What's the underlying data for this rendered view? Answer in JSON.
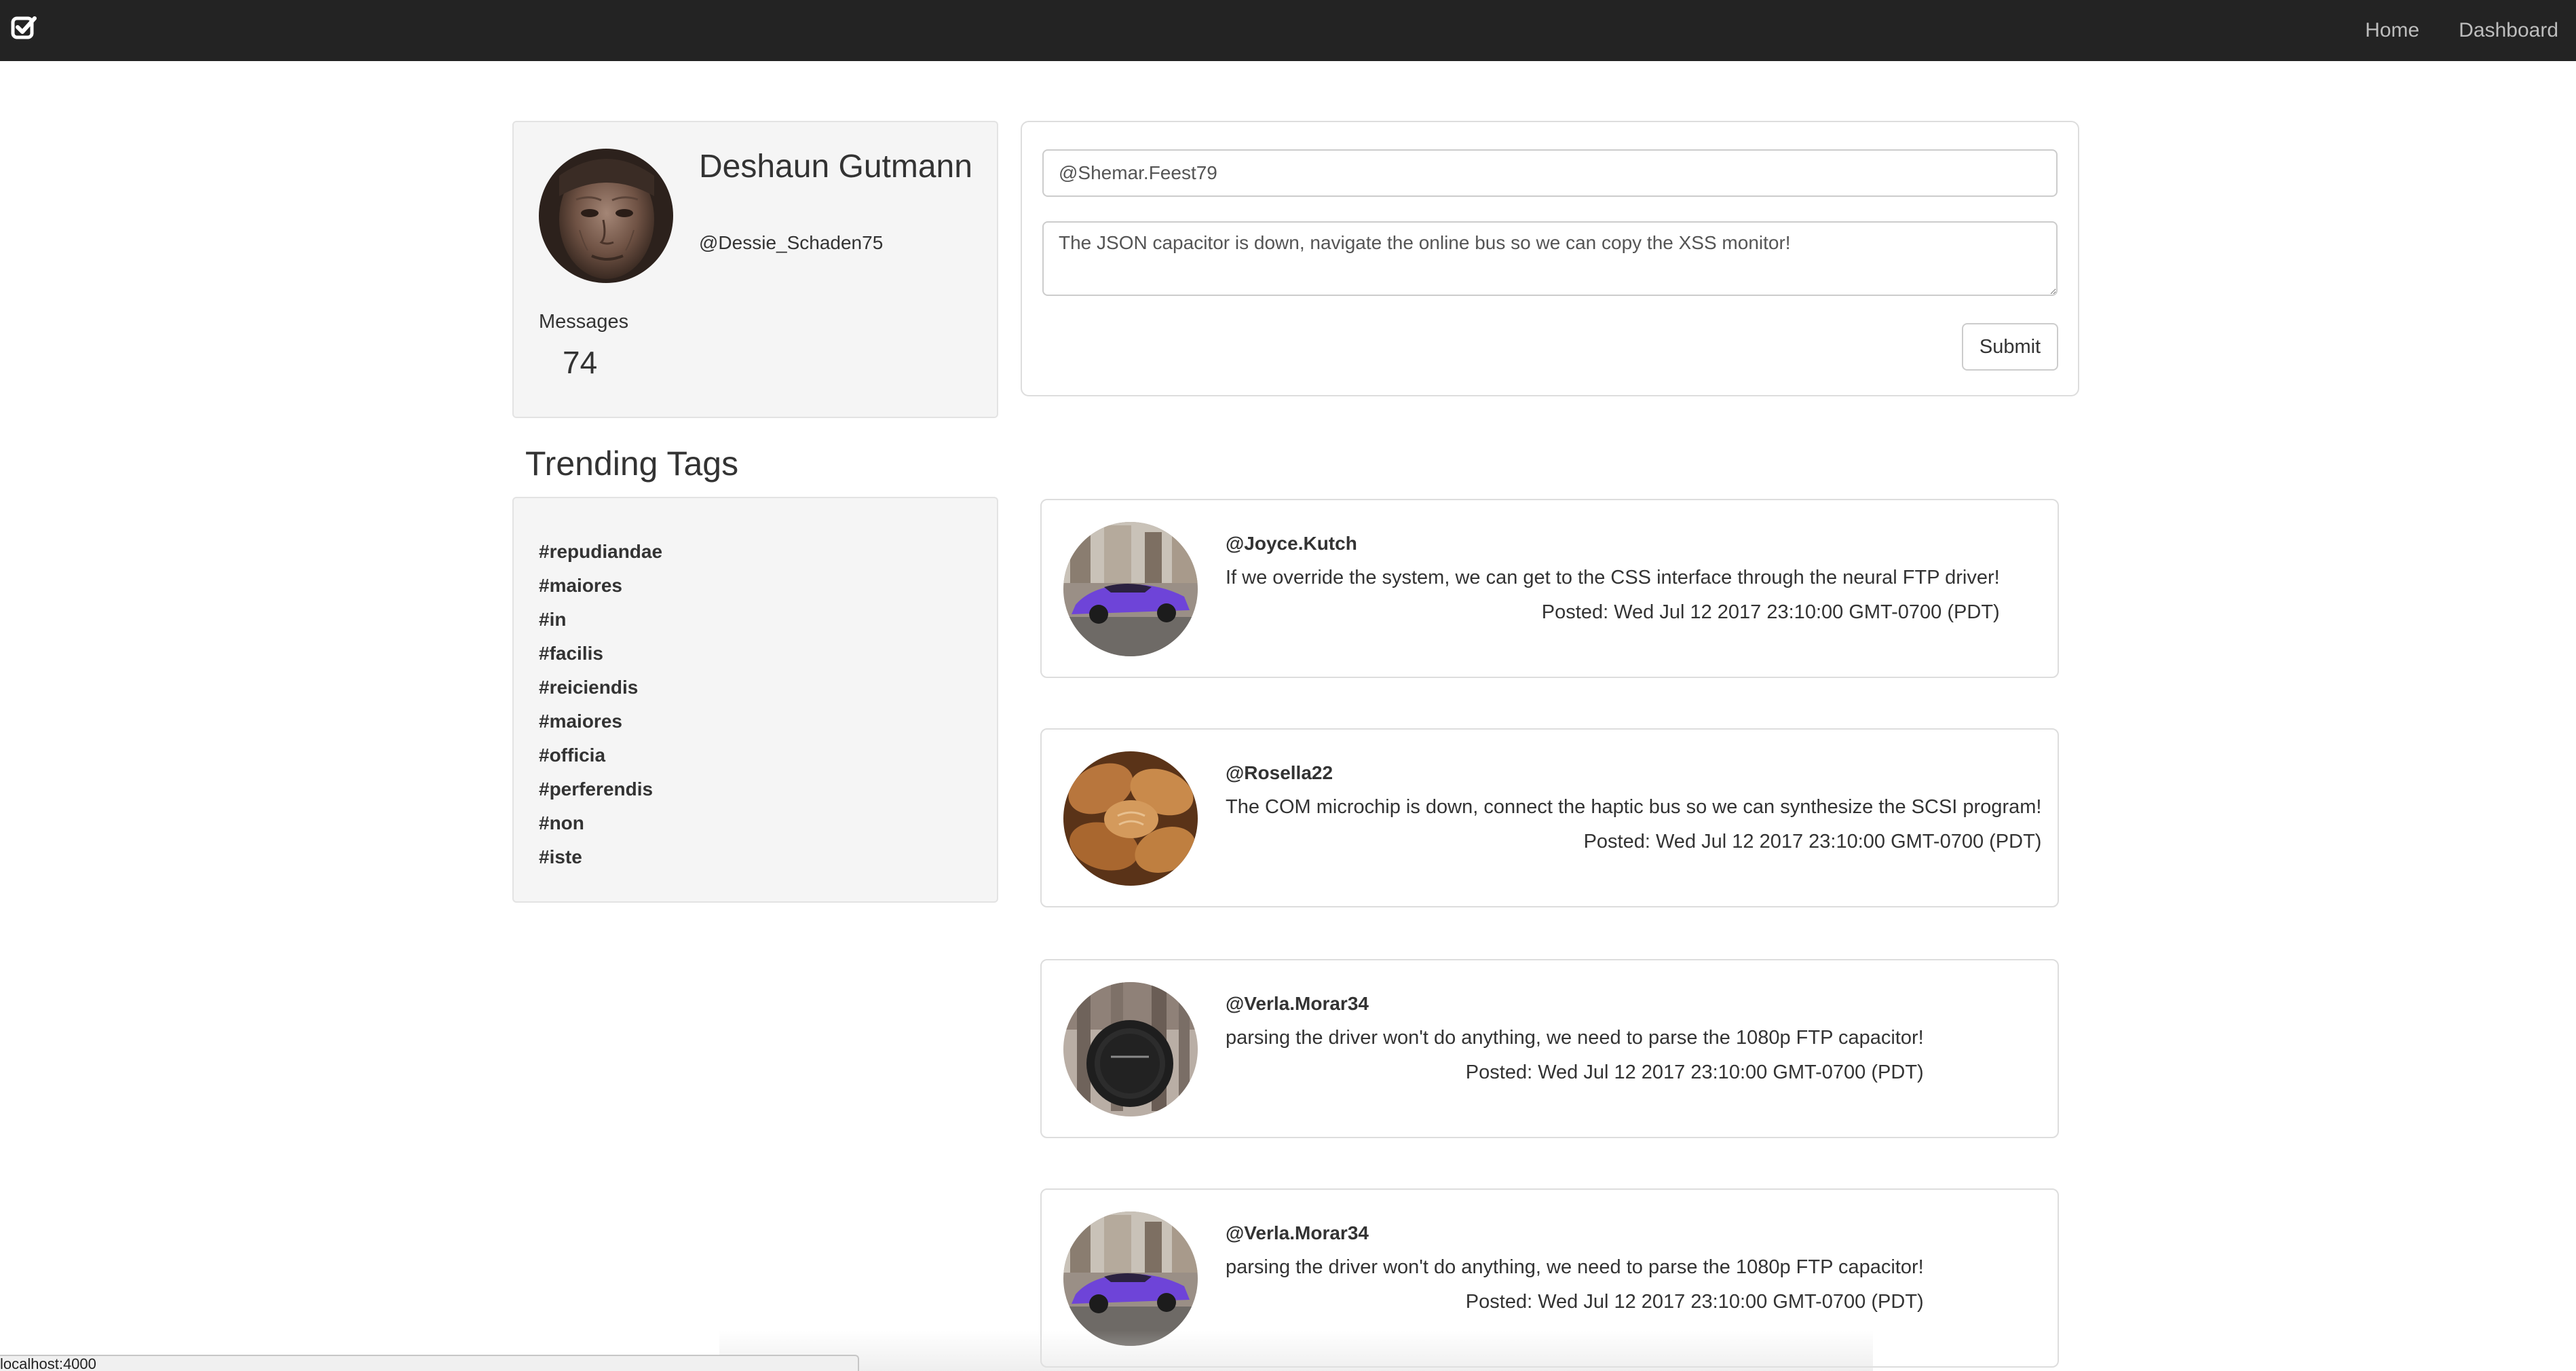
{
  "navbar": {
    "brand_icon": "check-square-icon",
    "links": [
      "Home",
      "Dashboard"
    ]
  },
  "profile": {
    "name": "Deshaun Gutmann",
    "handle": "@Dessie_Schaden75",
    "messages_label": "Messages",
    "messages_count": "74",
    "avatar": "elderly-person-portrait-photo"
  },
  "compose": {
    "handle_value": "@Shemar.Feest79",
    "message_value": "The JSON capacitor is down, navigate the online bus so we can copy the XSS monitor!",
    "submit_label": "Submit"
  },
  "trending": {
    "title": "Trending Tags",
    "tags": [
      "#repudiandae",
      "#maiores",
      "#in",
      "#facilis",
      "#reiciendis",
      "#maiores",
      "#officia",
      "#perferendis",
      "#non",
      "#iste"
    ]
  },
  "messages": [
    {
      "user": "@Joyce.Kutch",
      "text": "If we override the system, we can get to the CSS interface through the neural FTP driver!",
      "posted": "Posted: Wed Jul 12 2017 23:10:00 GMT-0700 (PDT)",
      "avatar": "purple-sports-car-photo"
    },
    {
      "user": "@Rosella22",
      "text": "The COM microchip is down, connect the haptic bus so we can synthesize the SCSI program!",
      "posted": "Posted: Wed Jul 12 2017 23:10:00 GMT-0700 (PDT)",
      "avatar": "bread-loaves-photo"
    },
    {
      "user": "@Verla.Morar34",
      "text": "parsing the driver won't do anything, we need to parse the 1080p FTP capacitor!",
      "posted": "Posted: Wed Jul 12 2017 23:10:00 GMT-0700 (PDT)",
      "avatar": "camera-lens-cap-photo"
    },
    {
      "user": "@Verla.Morar34",
      "text": "parsing the driver won't do anything, we need to parse the 1080p FTP capacitor!",
      "posted": "Posted: Wed Jul 12 2017 23:10:00 GMT-0700 (PDT)",
      "avatar": "purple-sports-car-photo"
    }
  ],
  "status_bar": {
    "text": "localhost:4000"
  },
  "colors": {
    "navbar_bg": "#232323",
    "nav_link": "#bdbdbd",
    "well_bg": "#f5f5f5",
    "border": "#dddddd",
    "text": "#333333"
  }
}
